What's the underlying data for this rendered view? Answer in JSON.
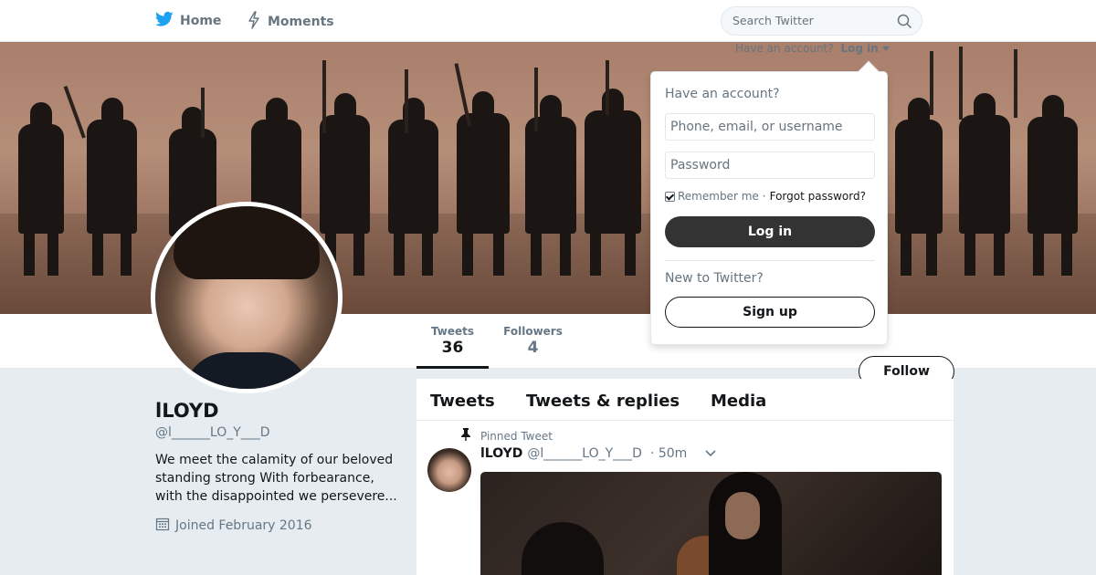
{
  "nav": {
    "home_label": "Home",
    "moments_label": "Moments",
    "search_placeholder": "Search Twitter"
  },
  "account_prompt": {
    "text": "Have an account?",
    "login_link": "Log in"
  },
  "stats": [
    {
      "label": "Tweets",
      "value": "36"
    },
    {
      "label": "Followers",
      "value": "4"
    }
  ],
  "follow_label": "Follow",
  "profile": {
    "name": "lLOYD",
    "handle": "@l______LO_Y___D",
    "bio": "We meet the calamity of our beloved standing strong With forbearance, with the disappointed we persevere...",
    "joined": "Joined February 2016"
  },
  "timeline": {
    "tabs": [
      "Tweets",
      "Tweets & replies",
      "Media"
    ],
    "pinned_label": "Pinned Tweet",
    "tweet": {
      "name": "lLOYD",
      "handle": "@l______LO_Y___D",
      "time": "· 50m"
    }
  },
  "login_dropdown": {
    "heading": "Have an account?",
    "username_placeholder": "Phone, email, or username",
    "password_placeholder": "Password",
    "remember_label": "Remember me",
    "separator": "·",
    "forgot_label": "Forgot password?",
    "login_button": "Log in",
    "new_prompt": "New to Twitter?",
    "signup_button": "Sign up"
  },
  "colors": {
    "twitter_blue": "#1da1f2",
    "text_primary": "#14171a",
    "text_secondary": "#657786",
    "page_bg": "#e6ecf0"
  },
  "icons": [
    "twitter-bird-icon",
    "lightning-icon",
    "search-icon",
    "caret-down-icon",
    "pin-icon",
    "calendar-icon",
    "chevron-down-icon"
  ]
}
